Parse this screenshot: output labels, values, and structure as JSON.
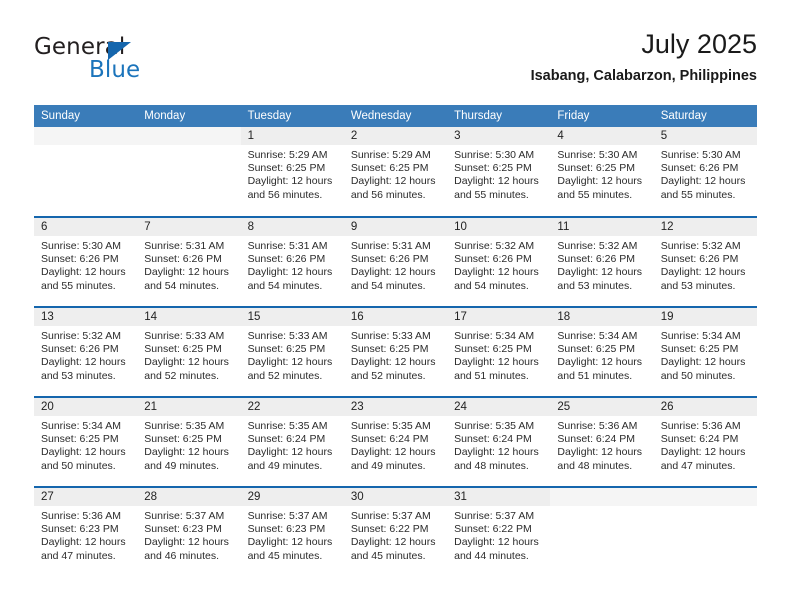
{
  "brand": {
    "name_top": "General",
    "name_bottom": "Blue",
    "logo_icon": "triangle-logo-icon"
  },
  "header": {
    "title": "July 2025",
    "location": "Isabang, Calabarzon, Philippines"
  },
  "calendar": {
    "weekday_headers": [
      "Sunday",
      "Monday",
      "Tuesday",
      "Wednesday",
      "Thursday",
      "Friday",
      "Saturday"
    ],
    "colors": {
      "header_bg": "#3a7cb9",
      "row_divider": "#1566ad",
      "daynum_bg": "#eeeeee",
      "brand_blue": "#1b74bb"
    },
    "weeks": [
      [
        {
          "day": "",
          "sunrise": "",
          "sunset": "",
          "daylight": ""
        },
        {
          "day": "",
          "sunrise": "",
          "sunset": "",
          "daylight": ""
        },
        {
          "day": "1",
          "sunrise": "Sunrise: 5:29 AM",
          "sunset": "Sunset: 6:25 PM",
          "daylight": "Daylight: 12 hours and 56 minutes."
        },
        {
          "day": "2",
          "sunrise": "Sunrise: 5:29 AM",
          "sunset": "Sunset: 6:25 PM",
          "daylight": "Daylight: 12 hours and 56 minutes."
        },
        {
          "day": "3",
          "sunrise": "Sunrise: 5:30 AM",
          "sunset": "Sunset: 6:25 PM",
          "daylight": "Daylight: 12 hours and 55 minutes."
        },
        {
          "day": "4",
          "sunrise": "Sunrise: 5:30 AM",
          "sunset": "Sunset: 6:25 PM",
          "daylight": "Daylight: 12 hours and 55 minutes."
        },
        {
          "day": "5",
          "sunrise": "Sunrise: 5:30 AM",
          "sunset": "Sunset: 6:26 PM",
          "daylight": "Daylight: 12 hours and 55 minutes."
        }
      ],
      [
        {
          "day": "6",
          "sunrise": "Sunrise: 5:30 AM",
          "sunset": "Sunset: 6:26 PM",
          "daylight": "Daylight: 12 hours and 55 minutes."
        },
        {
          "day": "7",
          "sunrise": "Sunrise: 5:31 AM",
          "sunset": "Sunset: 6:26 PM",
          "daylight": "Daylight: 12 hours and 54 minutes."
        },
        {
          "day": "8",
          "sunrise": "Sunrise: 5:31 AM",
          "sunset": "Sunset: 6:26 PM",
          "daylight": "Daylight: 12 hours and 54 minutes."
        },
        {
          "day": "9",
          "sunrise": "Sunrise: 5:31 AM",
          "sunset": "Sunset: 6:26 PM",
          "daylight": "Daylight: 12 hours and 54 minutes."
        },
        {
          "day": "10",
          "sunrise": "Sunrise: 5:32 AM",
          "sunset": "Sunset: 6:26 PM",
          "daylight": "Daylight: 12 hours and 54 minutes."
        },
        {
          "day": "11",
          "sunrise": "Sunrise: 5:32 AM",
          "sunset": "Sunset: 6:26 PM",
          "daylight": "Daylight: 12 hours and 53 minutes."
        },
        {
          "day": "12",
          "sunrise": "Sunrise: 5:32 AM",
          "sunset": "Sunset: 6:26 PM",
          "daylight": "Daylight: 12 hours and 53 minutes."
        }
      ],
      [
        {
          "day": "13",
          "sunrise": "Sunrise: 5:32 AM",
          "sunset": "Sunset: 6:26 PM",
          "daylight": "Daylight: 12 hours and 53 minutes."
        },
        {
          "day": "14",
          "sunrise": "Sunrise: 5:33 AM",
          "sunset": "Sunset: 6:25 PM",
          "daylight": "Daylight: 12 hours and 52 minutes."
        },
        {
          "day": "15",
          "sunrise": "Sunrise: 5:33 AM",
          "sunset": "Sunset: 6:25 PM",
          "daylight": "Daylight: 12 hours and 52 minutes."
        },
        {
          "day": "16",
          "sunrise": "Sunrise: 5:33 AM",
          "sunset": "Sunset: 6:25 PM",
          "daylight": "Daylight: 12 hours and 52 minutes."
        },
        {
          "day": "17",
          "sunrise": "Sunrise: 5:34 AM",
          "sunset": "Sunset: 6:25 PM",
          "daylight": "Daylight: 12 hours and 51 minutes."
        },
        {
          "day": "18",
          "sunrise": "Sunrise: 5:34 AM",
          "sunset": "Sunset: 6:25 PM",
          "daylight": "Daylight: 12 hours and 51 minutes."
        },
        {
          "day": "19",
          "sunrise": "Sunrise: 5:34 AM",
          "sunset": "Sunset: 6:25 PM",
          "daylight": "Daylight: 12 hours and 50 minutes."
        }
      ],
      [
        {
          "day": "20",
          "sunrise": "Sunrise: 5:34 AM",
          "sunset": "Sunset: 6:25 PM",
          "daylight": "Daylight: 12 hours and 50 minutes."
        },
        {
          "day": "21",
          "sunrise": "Sunrise: 5:35 AM",
          "sunset": "Sunset: 6:25 PM",
          "daylight": "Daylight: 12 hours and 49 minutes."
        },
        {
          "day": "22",
          "sunrise": "Sunrise: 5:35 AM",
          "sunset": "Sunset: 6:24 PM",
          "daylight": "Daylight: 12 hours and 49 minutes."
        },
        {
          "day": "23",
          "sunrise": "Sunrise: 5:35 AM",
          "sunset": "Sunset: 6:24 PM",
          "daylight": "Daylight: 12 hours and 49 minutes."
        },
        {
          "day": "24",
          "sunrise": "Sunrise: 5:35 AM",
          "sunset": "Sunset: 6:24 PM",
          "daylight": "Daylight: 12 hours and 48 minutes."
        },
        {
          "day": "25",
          "sunrise": "Sunrise: 5:36 AM",
          "sunset": "Sunset: 6:24 PM",
          "daylight": "Daylight: 12 hours and 48 minutes."
        },
        {
          "day": "26",
          "sunrise": "Sunrise: 5:36 AM",
          "sunset": "Sunset: 6:24 PM",
          "daylight": "Daylight: 12 hours and 47 minutes."
        }
      ],
      [
        {
          "day": "27",
          "sunrise": "Sunrise: 5:36 AM",
          "sunset": "Sunset: 6:23 PM",
          "daylight": "Daylight: 12 hours and 47 minutes."
        },
        {
          "day": "28",
          "sunrise": "Sunrise: 5:37 AM",
          "sunset": "Sunset: 6:23 PM",
          "daylight": "Daylight: 12 hours and 46 minutes."
        },
        {
          "day": "29",
          "sunrise": "Sunrise: 5:37 AM",
          "sunset": "Sunset: 6:23 PM",
          "daylight": "Daylight: 12 hours and 45 minutes."
        },
        {
          "day": "30",
          "sunrise": "Sunrise: 5:37 AM",
          "sunset": "Sunset: 6:22 PM",
          "daylight": "Daylight: 12 hours and 45 minutes."
        },
        {
          "day": "31",
          "sunrise": "Sunrise: 5:37 AM",
          "sunset": "Sunset: 6:22 PM",
          "daylight": "Daylight: 12 hours and 44 minutes."
        },
        {
          "day": "",
          "sunrise": "",
          "sunset": "",
          "daylight": ""
        },
        {
          "day": "",
          "sunrise": "",
          "sunset": "",
          "daylight": ""
        }
      ]
    ]
  }
}
